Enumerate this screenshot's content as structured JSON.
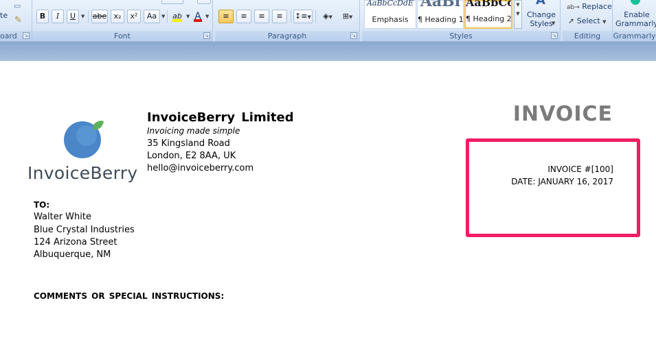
{
  "ribbon": {
    "groups": {
      "clipboard": "oard",
      "font": "Font",
      "paragraph": "Paragraph",
      "styles": "Styles",
      "editing": "Editing",
      "grammarly": "Grammarly"
    },
    "clipboard_fragment": "te",
    "font_buttons": {
      "bold": "B",
      "italic": "I",
      "underline": "U",
      "strike": "abe",
      "subscript": "x₂",
      "superscript": "x²",
      "change_case": "Aa",
      "highlight": "ab",
      "font_color": "A"
    },
    "styles": [
      {
        "sample": "AaBbCcDdE",
        "name": "Emphasis"
      },
      {
        "sample": "AaBl",
        "name": "¶ Heading 1"
      },
      {
        "sample": "AaBbCc",
        "name": "¶ Heading 2"
      }
    ],
    "change_styles_label": "Change Styles",
    "replace_label": "Replace",
    "select_label": "Select",
    "grammarly_label": "Enable Grammarly",
    "colors": {
      "accent": "#f8c95b",
      "ribbon": "#dce8f7"
    }
  },
  "document": {
    "logo_text": "InvoiceBerry",
    "company_name": "InvoiceBerry Limited",
    "tagline": "Invoicing made simple",
    "address": [
      "35 Kingsland Road",
      "London, E2 8AA, UK",
      "hello@invoiceberry.com"
    ],
    "invoice_title": "INVOICE",
    "invoice_number": "INVOICE #[100]",
    "invoice_date": "DATE: JANUARY 16, 2017",
    "to_label": "TO:",
    "recipient": [
      "Walter White",
      "Blue Crystal Industries",
      "124 Arizona Street",
      "Albuquerque, NM"
    ],
    "comments_label": "COMMENTS OR SPECIAL INSTRUCTIONS:",
    "colors": {
      "highlight": "#f01e63",
      "title": "#7b7b7b",
      "logo_blue": "#4a86c8",
      "logo_green": "#5db05a"
    }
  }
}
